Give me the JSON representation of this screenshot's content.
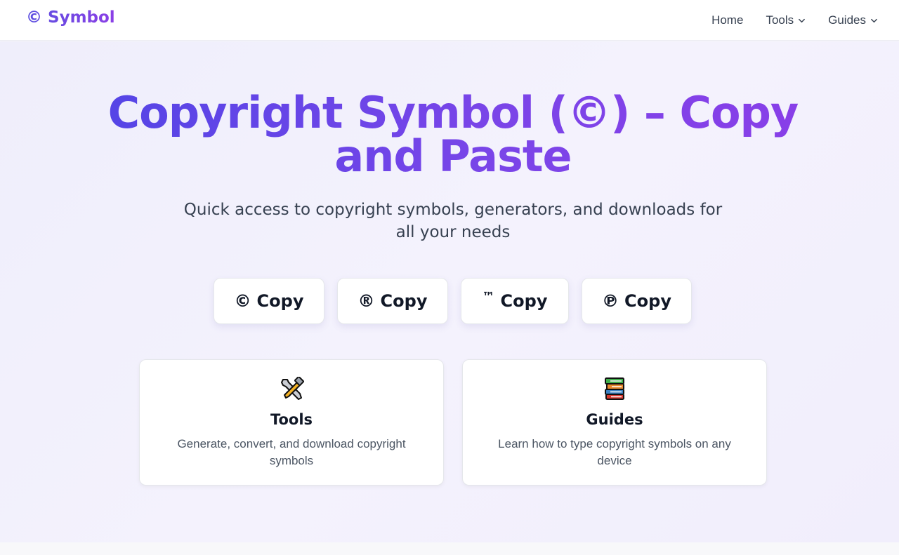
{
  "brand": {
    "symbol": "©",
    "name": "Symbol"
  },
  "nav": {
    "items": [
      {
        "label": "Home",
        "dropdown": false
      },
      {
        "label": "Tools",
        "dropdown": true
      },
      {
        "label": "Guides",
        "dropdown": true
      }
    ]
  },
  "hero": {
    "title": "Copyright Symbol (©) – Copy and Paste",
    "subtitle": "Quick access to copyright symbols, generators, and downloads for all your needs"
  },
  "copy_buttons": [
    {
      "symbol": "©",
      "label": "Copy"
    },
    {
      "symbol": "®",
      "label": "Copy"
    },
    {
      "symbol": "™",
      "label": "Copy"
    },
    {
      "symbol": "℗",
      "label": "Copy"
    }
  ],
  "cards": [
    {
      "icon": "tools-icon",
      "title": "Tools",
      "description": "Generate, convert, and download copyright symbols"
    },
    {
      "icon": "books-icon",
      "title": "Guides",
      "description": "Learn how to type copyright symbols on any device"
    }
  ],
  "colors": {
    "brand_gradient_start": "#5145e6",
    "brand_gradient_end": "#8a3ee8",
    "hero_background": "#f1effc"
  }
}
